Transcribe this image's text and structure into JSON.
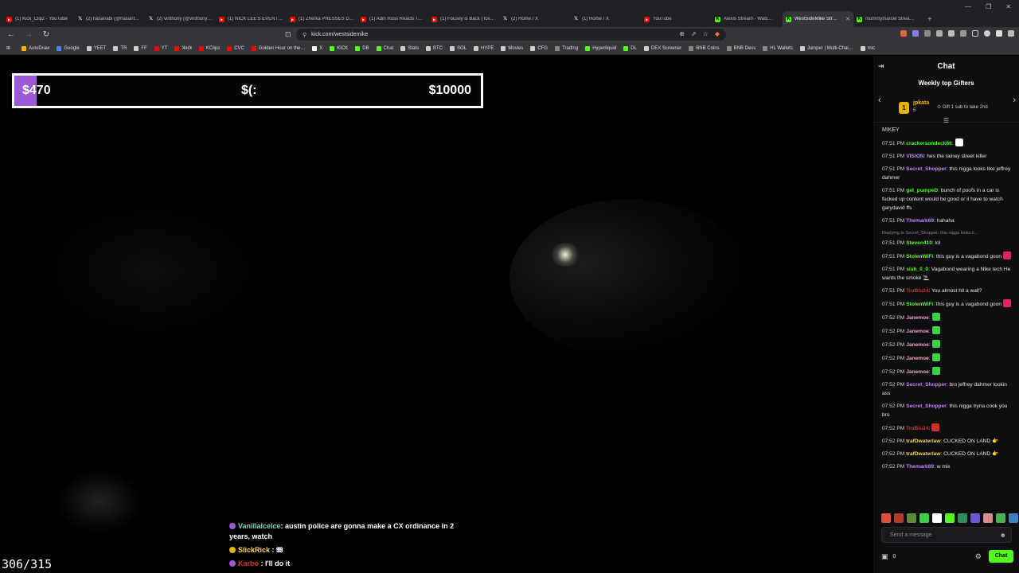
{
  "browser": {
    "tabs": [
      {
        "label": "(1) Kick_Clipz - YouTube",
        "icon": "youtube-icon",
        "color": "#ff0000"
      },
      {
        "label": "(2) hasanabi (@hasanth…",
        "icon": "x-icon",
        "color": "#ffffff"
      },
      {
        "label": "(2) vinthony (@vinthony_…",
        "icon": "x-icon",
        "color": "#ffffff"
      },
      {
        "label": "(1) NICK LEE'S EVENT SC…",
        "icon": "youtube-icon",
        "color": "#ff0000"
      },
      {
        "label": "(1) Zherka PRESSES Dum…",
        "icon": "youtube-icon",
        "color": "#ff0000"
      },
      {
        "label": "(1) Adin Ross Reacts To I…",
        "icon": "youtube-icon",
        "color": "#ff0000"
      },
      {
        "label": "(1) Fousey is Back | Ice P…",
        "icon": "youtube-icon",
        "color": "#ff0000"
      },
      {
        "label": "(2) Home / X",
        "icon": "x-icon",
        "color": "#ffffff"
      },
      {
        "label": "(1) Home / X",
        "icon": "x-icon",
        "color": "#ffffff"
      },
      {
        "label": "YouTube",
        "icon": "youtube-icon",
        "color": "#ff0000"
      },
      {
        "label": "Alexis Stream - Watc…",
        "icon": "kick-icon",
        "color": "#53fc18"
      },
      {
        "label": "WestSideMike Str…",
        "icon": "kick-icon",
        "color": "#53fc18",
        "active": true
      },
      {
        "label": "mommymarcel Strea…",
        "icon": "kick-icon",
        "color": "#53fc18"
      }
    ],
    "new_tab": "+",
    "url": "kick.com/westsidemike",
    "bookmarks": [
      {
        "label": "AutoDraw",
        "color": "#f4b400"
      },
      {
        "label": "Google",
        "color": "#4285f4"
      },
      {
        "label": "YEET",
        "color": "#cccccc"
      },
      {
        "label": "TR",
        "color": "#cccccc"
      },
      {
        "label": "FF",
        "color": "#cccccc"
      },
      {
        "label": "YT",
        "color": "#ff0000"
      },
      {
        "label": "ꓘᴙᴉꓘ",
        "color": "#ff0000"
      },
      {
        "label": "KClips",
        "color": "#ff0000"
      },
      {
        "label": "CVC",
        "color": "#ff0000"
      },
      {
        "label": "Golden Hour on the…",
        "color": "#ff0000"
      },
      {
        "label": "X",
        "color": "#ffffff"
      },
      {
        "label": "KICK",
        "color": "#53fc18"
      },
      {
        "label": "DB",
        "color": "#53fc18"
      },
      {
        "label": "Chat",
        "color": "#53fc18"
      },
      {
        "label": "Stats",
        "color": "#cccccc"
      },
      {
        "label": "BTC",
        "color": "#cccccc"
      },
      {
        "label": "SOL",
        "color": "#cccccc"
      },
      {
        "label": "HYPE",
        "color": "#cccccc"
      },
      {
        "label": "Movies",
        "color": "#cccccc"
      },
      {
        "label": "CFG",
        "color": "#cccccc"
      },
      {
        "label": "Trading",
        "color": "#888888"
      },
      {
        "label": "Hyperliquid",
        "color": "#53fc18"
      },
      {
        "label": "DL",
        "color": "#53fc18"
      },
      {
        "label": "DEX Screener",
        "color": "#cccccc"
      },
      {
        "label": "BNB Coins",
        "color": "#888888"
      },
      {
        "label": "BNB Devs",
        "color": "#888888"
      },
      {
        "label": "HL Wallets",
        "color": "#888888"
      },
      {
        "label": "Jumper | Multi-Chai…",
        "color": "#cccccc"
      },
      {
        "label": "mic",
        "color": "#cccccc"
      }
    ]
  },
  "stream": {
    "goal": {
      "current": "$470",
      "middle": "$(:",
      "target": "$10000",
      "progress": 0.047,
      "fill_color": "#9b59d9"
    },
    "frame_counter": "306/315",
    "overlay_messages": [
      {
        "user": "VanillaIceIce",
        "text": ": austin police are gonna make a CX ordinance in 2 years, watch",
        "color": "#7fd4a8",
        "badge_color": "#9b59d9"
      },
      {
        "user": "SlickRick",
        "text": " : 𝖂",
        "color": "#f5d442",
        "badge_color": "#e5b200"
      },
      {
        "user": "Karbo",
        "text": " : I'll do it",
        "color": "#d62d2d",
        "badge_color": "#9b59d9"
      }
    ]
  },
  "chat": {
    "title": "Chat",
    "gifters": {
      "title": "Weekly top Gifters",
      "rank": "1",
      "name": "jpkata",
      "count": "5",
      "tip": "Gift 1 sub to take 2nd"
    },
    "pinned": "MIKEY",
    "messages": [
      {
        "time": "07:51 PM",
        "user": "crackersondeck66",
        "color": "#53fc18",
        "text": ":",
        "emote": "#ffffff"
      },
      {
        "time": "07:51 PM",
        "user": "VISION",
        "color": "#c77dff",
        "text": ": hes the rainey street killer"
      },
      {
        "time": "07:51 PM",
        "user": "Secret_Shopper",
        "color": "#c77dff",
        "text": ": this nigga looks like jeffrey dahmer"
      },
      {
        "time": "07:51 PM",
        "user": "get_pumpeD",
        "color": "#53fc18",
        "text": ": bunch of poofs in a car is fucked up content would be good or il have to watch garydavid ffs"
      },
      {
        "time": "07:51 PM",
        "user": "Themark69",
        "color": "#c77dff",
        "text": ": hahaha"
      },
      {
        "reply": "Replying to Secret_Shopper: this nigga looks li…",
        "time": "07:51 PM",
        "user": "Steven410",
        "color": "#53fc18",
        "text": ": lol"
      },
      {
        "time": "07:51 PM",
        "user": "StolenWiFi",
        "color": "#53fc18",
        "text": ": this guy is a vagabond goon",
        "emote": "#e0245e"
      },
      {
        "time": "07:51 PM",
        "user": "sish_0_0",
        "color": "#53fc18",
        "text": ": Vagabond wearing a Nike tech He wants the smoke 🚬"
      },
      {
        "time": "07:51 PM",
        "user": "TruBlu24",
        "color": "#d62d2d",
        "text": ": You almost hit a wall?"
      },
      {
        "time": "07:51 PM",
        "user": "StolenWiFi",
        "color": "#53fc18",
        "text": ": this guy is a vagabond goon",
        "emote": "#e0245e"
      },
      {
        "time": "07:52 PM",
        "user": "Janemoe",
        "color": "#f0a0d0",
        "text": ":",
        "emote": "#3ecf4a"
      },
      {
        "time": "07:52 PM",
        "user": "Janemoe",
        "color": "#f0a0d0",
        "text": ":",
        "emote": "#3ecf4a"
      },
      {
        "time": "07:52 PM",
        "user": "Janemoe",
        "color": "#f0a0d0",
        "text": ":",
        "emote": "#3ecf4a"
      },
      {
        "time": "07:52 PM",
        "user": "Janemoe",
        "color": "#f0a0d0",
        "text": ":",
        "emote": "#3ecf4a"
      },
      {
        "time": "07:52 PM",
        "user": "Janemoe",
        "color": "#f0a0d0",
        "text": ":",
        "emote": "#3ecf4a"
      },
      {
        "time": "07:52 PM",
        "user": "Secret_Shopper",
        "color": "#c77dff",
        "text": ": bro jeffrey dahmer lookin ass"
      },
      {
        "time": "07:52 PM",
        "user": "Secret_Shopper",
        "color": "#c77dff",
        "text": ": this nigga tryna cook you bro"
      },
      {
        "time": "07:52 PM",
        "user": "TruBlu24",
        "color": "#d62d2d",
        "text": ":",
        "emote": "#d62d2d"
      },
      {
        "time": "07:52 PM",
        "user": "trafDwaterlaw",
        "color": "#f5d442",
        "text": ": CUCKED ON LAND 👉"
      },
      {
        "time": "07:52 PM",
        "user": "trafDwaterlaw",
        "color": "#f5d442",
        "text": ": CUCKED ON LAND 👉"
      },
      {
        "time": "07:52 PM",
        "user": "Themark69",
        "color": "#c77dff",
        "text": ": w mix"
      }
    ],
    "emote_bar": [
      "#d94f3a",
      "#b03a2e",
      "#5a8a3a",
      "#3ecf4a",
      "#ffffff",
      "#53fc18",
      "#2e8b57",
      "#6a5acd",
      "#d98c8c",
      "#4caf50",
      "#3f7fbf",
      "#a0a0a0"
    ],
    "input_placeholder": "Send a message",
    "points": "0",
    "send_label": "Chat"
  }
}
